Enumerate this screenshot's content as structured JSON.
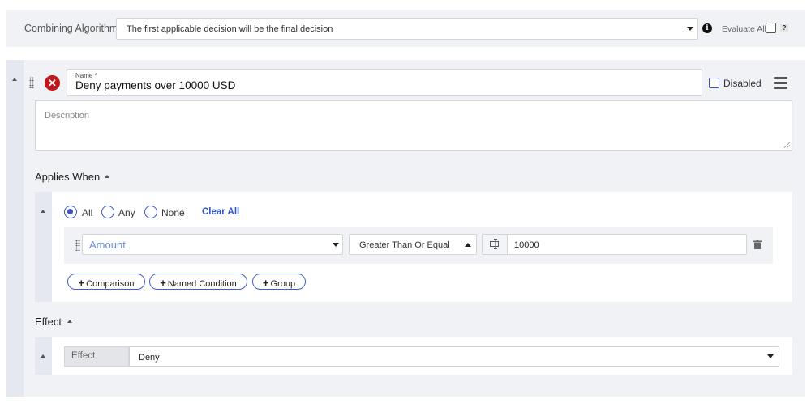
{
  "combining": {
    "label": "Combining Algorithm",
    "selected": "The first applicable decision will be the final decision",
    "info_icon": "info-circle-icon",
    "evaluate_all_label": "Evaluate All",
    "evaluate_all_checked": false,
    "help_text": "?"
  },
  "rule": {
    "name_label": "Name *",
    "name_value": "Deny payments over 10000 USD",
    "decision_icon": "deny-x-icon",
    "disabled_label": "Disabled",
    "disabled_checked": false,
    "description_placeholder": "Description"
  },
  "applies_when": {
    "title": "Applies When",
    "match_options": [
      {
        "label": "All",
        "selected": true
      },
      {
        "label": "Any",
        "selected": false
      },
      {
        "label": "None",
        "selected": false
      }
    ],
    "clear_all_label": "Clear All",
    "condition": {
      "field": "Amount",
      "operator": "Greater Than Or Equal",
      "value": "10000"
    },
    "add_buttons": [
      {
        "plus": "+",
        "label": "Comparison"
      },
      {
        "plus": "+",
        "label": "Named Condition"
      },
      {
        "plus": "+",
        "label": "Group"
      }
    ]
  },
  "effect": {
    "title": "Effect",
    "label": "Effect",
    "value": "Deny"
  },
  "colors": {
    "accent": "#3a56c4",
    "deny": "#c0161c",
    "panel_bg": "#f1f2f6"
  }
}
